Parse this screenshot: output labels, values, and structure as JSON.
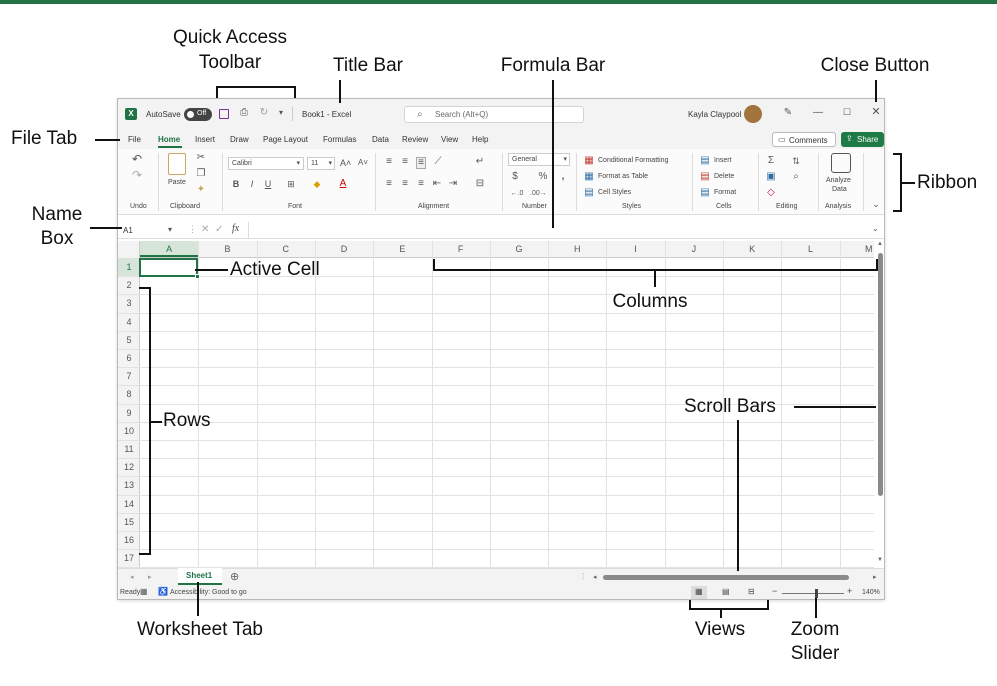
{
  "callouts": {
    "quick_access_line1": "Quick Access",
    "quick_access_line2": "Toolbar",
    "title_bar": "Title Bar",
    "formula_bar": "Formula Bar",
    "close_button": "Close Button",
    "file_tab": "File Tab",
    "ribbon": "Ribbon",
    "name_box_line1": "Name",
    "name_box_line2": "Box",
    "active_cell": "Active Cell",
    "columns": "Columns",
    "rows": "Rows",
    "scroll_bars": "Scroll Bars",
    "worksheet_tab": "Worksheet Tab",
    "views": "Views",
    "zoom_line1": "Zoom",
    "zoom_line2": "Slider"
  },
  "titlebar": {
    "autosave": "AutoSave",
    "autosave_state": "Off",
    "doc_title": "Book1 - Excel",
    "search_placeholder": "Search (Alt+Q)",
    "user": "Kayla Claypool"
  },
  "menu": [
    "File",
    "Home",
    "Insert",
    "Draw",
    "Page Layout",
    "Formulas",
    "Data",
    "Review",
    "View",
    "Help"
  ],
  "menu_active": "Home",
  "buttons": {
    "comments": "Comments",
    "share": "Share"
  },
  "ribbon": {
    "font_name": "Calibri",
    "font_size": "11",
    "number_format": "General",
    "paste": "Paste",
    "conditional_formatting": "Conditional Formatting",
    "format_as_table": "Format as Table",
    "cell_styles": "Cell Styles",
    "insert": "Insert",
    "delete": "Delete",
    "format": "Format",
    "analyze_line1": "Analyze",
    "analyze_line2": "Data",
    "groups": [
      "Undo",
      "Clipboard",
      "Font",
      "Alignment",
      "Number",
      "Styles",
      "Cells",
      "Editing",
      "Analysis"
    ]
  },
  "formula": {
    "name_box": "A1",
    "fx": "fx"
  },
  "columns": [
    "A",
    "B",
    "C",
    "D",
    "E",
    "F",
    "G",
    "H",
    "I",
    "J",
    "K",
    "L",
    "M"
  ],
  "rows": [
    "1",
    "2",
    "3",
    "4",
    "5",
    "6",
    "7",
    "8",
    "9",
    "10",
    "11",
    "12",
    "13",
    "14",
    "15",
    "16",
    "17"
  ],
  "sheet_tab": "Sheet1",
  "status": {
    "ready": "Ready",
    "accessibility": "Accessibility: Good to go",
    "zoom": "140%"
  },
  "colors": {
    "excel_green": "#217346",
    "share_green": "#1e7b45"
  }
}
